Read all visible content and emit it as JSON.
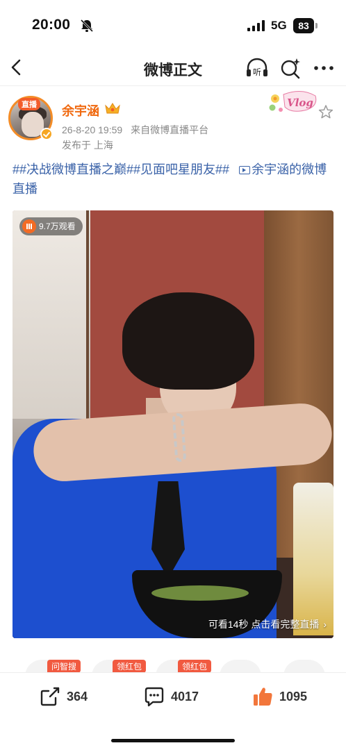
{
  "status_bar": {
    "time": "20:00",
    "network": "5G",
    "battery": "83",
    "icons": [
      "bell-slash-icon",
      "signal-icon"
    ]
  },
  "nav": {
    "title": "微博正文",
    "icons": [
      "back-chevron-icon",
      "listen-icon",
      "magic-search-icon",
      "more-icon"
    ],
    "listen_glyph": "听"
  },
  "post": {
    "avatar_badge": "直播",
    "username": "余宇涵",
    "date": "26-8-20 19:59",
    "source": "来自微博直播平台",
    "location": "发布于 上海",
    "sticker_text": "Vlog",
    "text_prefix": "##决战微博直播之巅##见面吧星朋友##",
    "video_link": "余宇涵的微博直播"
  },
  "media": {
    "views": "9.7万观看",
    "replay_hint": "可看14秒 点击看完整直播",
    "chevron": "›"
  },
  "hot_tags": [
    "问智搜",
    "领红包",
    "领红包"
  ],
  "actions": {
    "share_count": "364",
    "comment_count": "4017",
    "like_count": "1095"
  },
  "colors": {
    "username": "#f06a11",
    "hashtag": "#3a62a8",
    "live_badge": "#f35c2a",
    "hot_tag": "#f15a40",
    "like": "#f2763b"
  }
}
